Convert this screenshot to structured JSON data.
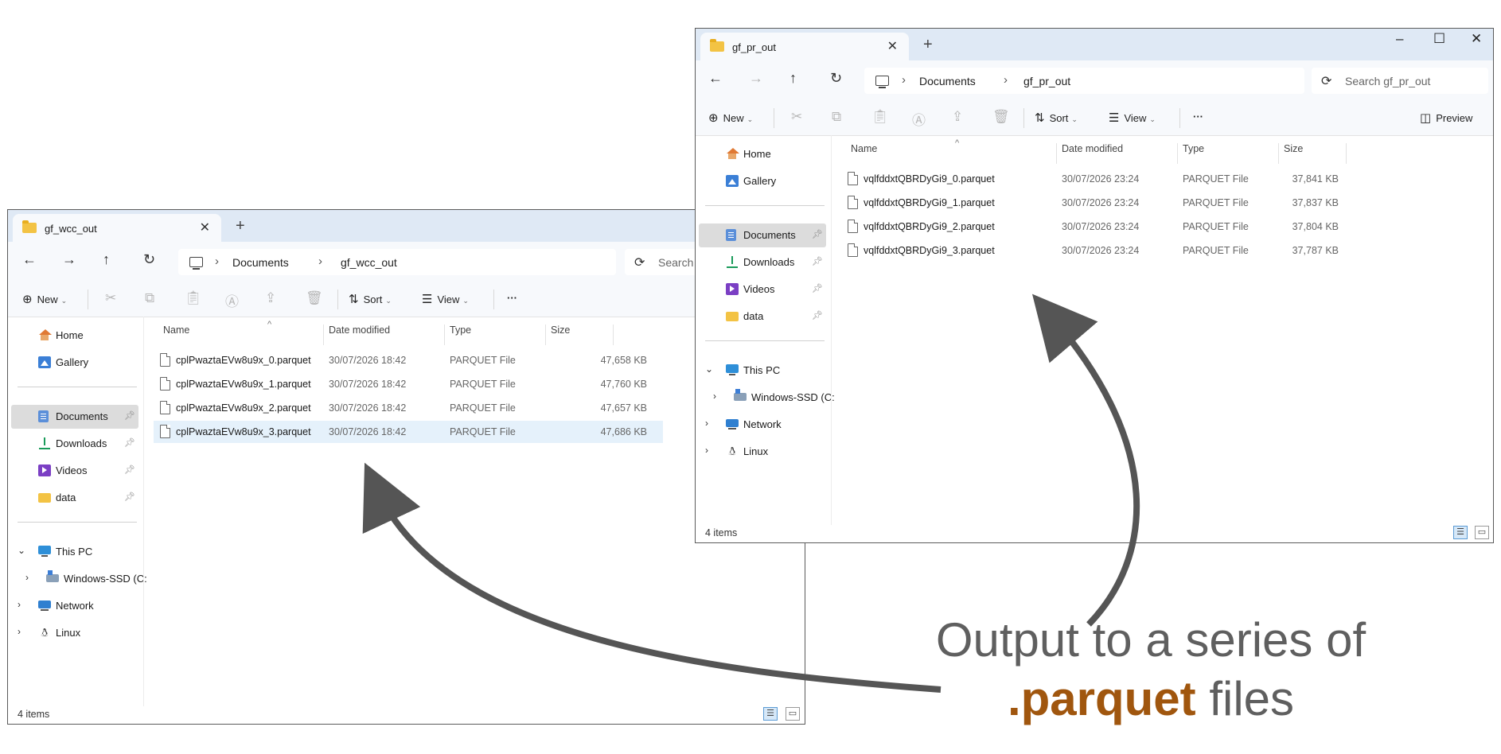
{
  "colors": {
    "accent": "#a0560e",
    "arrow": "#555555",
    "selected_row": "#e5f1fb"
  },
  "windows": {
    "left": {
      "tab_title": "gf_wcc_out",
      "breadcrumb": [
        "Documents",
        "gf_wcc_out"
      ],
      "search_placeholder": "Search",
      "toolbar": {
        "new_label": "New",
        "sort_label": "Sort",
        "view_label": "View",
        "more_label": "···"
      },
      "sidebar": {
        "home": "Home",
        "gallery": "Gallery",
        "documents": "Documents",
        "downloads": "Downloads",
        "videos": "Videos",
        "data": "data",
        "this_pc": "This PC",
        "drive": "Windows-SSD (C:",
        "network": "Network",
        "linux": "Linux"
      },
      "columns": [
        "Name",
        "Date modified",
        "Type",
        "Size"
      ],
      "files": [
        {
          "name": "cplPwaztaEVw8u9x_0.parquet",
          "date": "30/07/2026 18:42",
          "type": "PARQUET File",
          "size": "47,658 KB"
        },
        {
          "name": "cplPwaztaEVw8u9x_1.parquet",
          "date": "30/07/2026 18:42",
          "type": "PARQUET File",
          "size": "47,760 KB"
        },
        {
          "name": "cplPwaztaEVw8u9x_2.parquet",
          "date": "30/07/2026 18:42",
          "type": "PARQUET File",
          "size": "47,657 KB"
        },
        {
          "name": "cplPwaztaEVw8u9x_3.parquet",
          "date": "30/07/2026 18:42",
          "type": "PARQUET File",
          "size": "47,686 KB"
        }
      ],
      "status": "4 items"
    },
    "right": {
      "tab_title": "gf_pr_out",
      "breadcrumb": [
        "Documents",
        "gf_pr_out"
      ],
      "search_placeholder": "Search gf_pr_out",
      "toolbar": {
        "new_label": "New",
        "sort_label": "Sort",
        "view_label": "View",
        "more_label": "···",
        "preview_label": "Preview"
      },
      "sidebar": {
        "home": "Home",
        "gallery": "Gallery",
        "documents": "Documents",
        "downloads": "Downloads",
        "videos": "Videos",
        "data": "data",
        "this_pc": "This PC",
        "drive": "Windows-SSD (C:",
        "network": "Network",
        "linux": "Linux"
      },
      "columns": [
        "Name",
        "Date modified",
        "Type",
        "Size"
      ],
      "files": [
        {
          "name": "vqlfddxtQBRDyGi9_0.parquet",
          "date": "30/07/2026 23:24",
          "type": "PARQUET File",
          "size": "37,841 KB"
        },
        {
          "name": "vqlfddxtQBRDyGi9_1.parquet",
          "date": "30/07/2026 23:24",
          "type": "PARQUET File",
          "size": "37,837 KB"
        },
        {
          "name": "vqlfddxtQBRDyGi9_2.parquet",
          "date": "30/07/2026 23:24",
          "type": "PARQUET File",
          "size": "37,804 KB"
        },
        {
          "name": "vqlfddxtQBRDyGi9_3.parquet",
          "date": "30/07/2026 23:24",
          "type": "PARQUET File",
          "size": "37,787 KB"
        }
      ],
      "status": "4 items"
    }
  },
  "caption": {
    "line1": "Output to a series of",
    "accent": ".parquet",
    "tail": " files"
  }
}
